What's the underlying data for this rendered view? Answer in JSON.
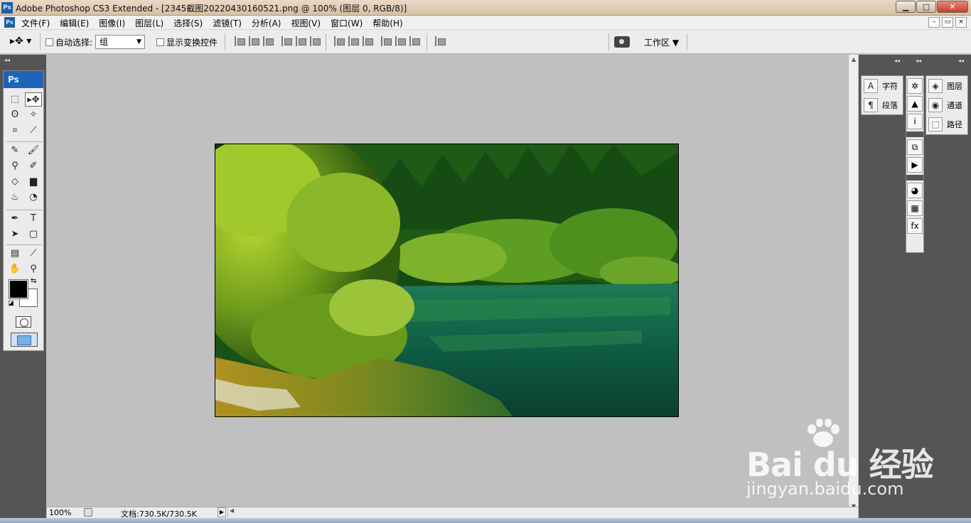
{
  "window": {
    "app_icon": "Ps",
    "title": "Adobe Photoshop CS3 Extended - [2345截图20220430160521.png @ 100% (图层 0, RGB/8)]",
    "controls": {
      "minimize": "▁",
      "maximize": "□",
      "close": "✕"
    }
  },
  "menubar": {
    "icon": "Ps",
    "items": [
      "文件(F)",
      "编辑(E)",
      "图像(I)",
      "图层(L)",
      "选择(S)",
      "滤镜(T)",
      "分析(A)",
      "视图(V)",
      "窗口(W)",
      "帮助(H)"
    ],
    "doc_controls": {
      "minimize": "–",
      "restore": "▭",
      "close": "×"
    }
  },
  "options": {
    "tool_preset": "▸✥ ▾",
    "auto_select_label": "自动选择:",
    "auto_select_value": "组",
    "show_transform_label": "显示变换控件",
    "workspace_label": "工作区",
    "workspace_arrow": "▼"
  },
  "toolbox": {
    "header": "Ps",
    "tools": [
      {
        "name": "marquee-icon",
        "glyph": "⬚"
      },
      {
        "name": "move-icon",
        "glyph": "▸✥",
        "active": true
      },
      {
        "name": "lasso-icon",
        "glyph": "ʘ"
      },
      {
        "name": "magic-wand-icon",
        "glyph": "✧"
      },
      {
        "name": "crop-icon",
        "glyph": "⌗"
      },
      {
        "name": "slice-icon",
        "glyph": "⟋"
      },
      {
        "name": "healing-brush-icon",
        "glyph": "✎"
      },
      {
        "name": "brush-icon",
        "glyph": "🖌"
      },
      {
        "name": "clone-stamp-icon",
        "glyph": "⚲"
      },
      {
        "name": "history-brush-icon",
        "glyph": "✐"
      },
      {
        "name": "eraser-icon",
        "glyph": "◇"
      },
      {
        "name": "gradient-icon",
        "glyph": "▆"
      },
      {
        "name": "blur-icon",
        "glyph": "♨"
      },
      {
        "name": "dodge-icon",
        "glyph": "◔"
      },
      {
        "name": "pen-icon",
        "glyph": "✒"
      },
      {
        "name": "type-icon",
        "glyph": "T"
      },
      {
        "name": "path-select-icon",
        "glyph": "➤"
      },
      {
        "name": "shape-icon",
        "glyph": "▢"
      },
      {
        "name": "notes-icon",
        "glyph": "▤"
      },
      {
        "name": "eyedropper-icon",
        "glyph": "⟋"
      },
      {
        "name": "hand-icon",
        "glyph": "✋"
      },
      {
        "name": "zoom-icon",
        "glyph": "⚲"
      }
    ],
    "foreground": "#000000",
    "background": "#ffffff"
  },
  "status": {
    "zoom": "100%",
    "doc_size": "文档:730.5K/730.5K",
    "arrow": "▶"
  },
  "panels": {
    "col1": [
      {
        "icon": "character-icon",
        "glyph": "A",
        "label": "字符"
      },
      {
        "icon": "paragraph-icon",
        "glyph": "¶",
        "label": "段落"
      }
    ],
    "col2": [
      {
        "icon": "navigator-icon",
        "glyph": "✲"
      },
      {
        "icon": "histogram-icon",
        "glyph": "▲"
      },
      {
        "icon": "info-icon",
        "glyph": "i"
      },
      {
        "icon": "history-icon",
        "glyph": "⧉"
      },
      {
        "icon": "actions-icon",
        "glyph": "▶"
      },
      {
        "icon": "swatches-icon",
        "glyph": "◕"
      },
      {
        "icon": "styles-icon",
        "glyph": "▦"
      },
      {
        "icon": "fx-icon",
        "glyph": "fx"
      }
    ],
    "col3": [
      {
        "icon": "layers-icon",
        "glyph": "◈",
        "label": "图层"
      },
      {
        "icon": "channels-icon",
        "glyph": "◉",
        "label": "通道"
      },
      {
        "icon": "paths-icon",
        "glyph": "⬚",
        "label": "路径"
      }
    ]
  },
  "watermark": {
    "logo": "Bai du 经验",
    "url": "jingyan.baidu.com"
  }
}
